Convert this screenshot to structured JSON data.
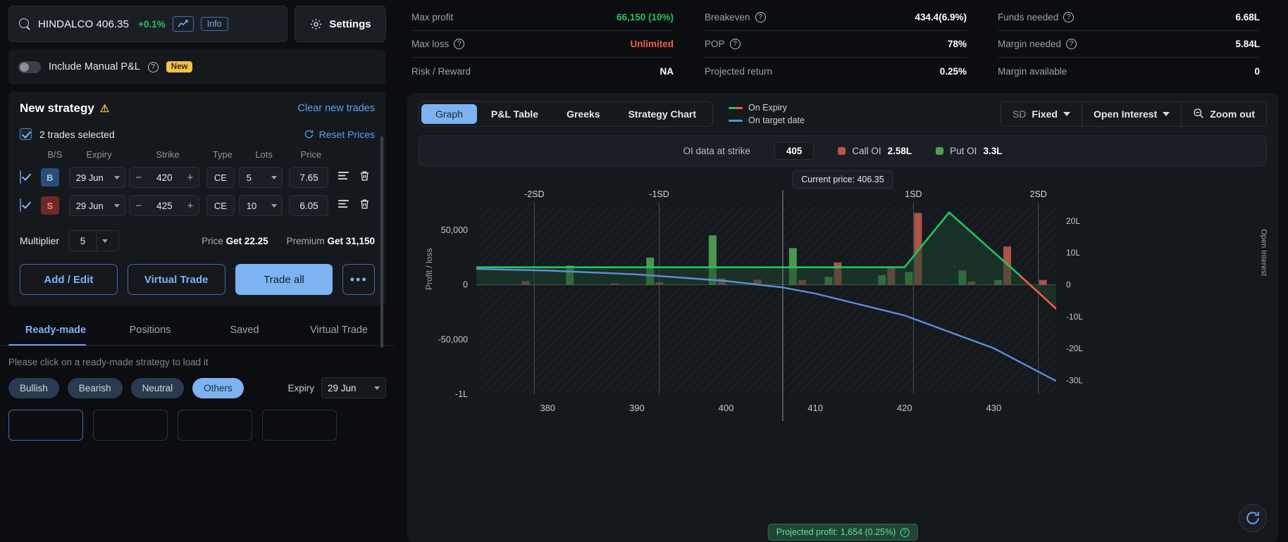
{
  "search": {
    "symbol": "HINDALCO 406.35",
    "change_pct": "+0.1%",
    "info_label": "Info",
    "chart_icon": "line-chart-icon",
    "search_icon": "search-icon"
  },
  "settings": {
    "label": "Settings",
    "icon": "gear-icon"
  },
  "manual_pnl": {
    "label": "Include Manual P&L",
    "badge": "New",
    "toggle_state": "off"
  },
  "strategy": {
    "title": "New strategy",
    "warn_icon": "warning-triangle-icon",
    "clear_label": "Clear new trades",
    "selected_label": "2 trades selected",
    "reset_label": "Reset Prices",
    "columns": [
      "B/S",
      "Expiry",
      "Strike",
      "Type",
      "Lots",
      "Price"
    ],
    "rows": [
      {
        "checked": true,
        "bs": "B",
        "bs_kind": "buy",
        "expiry": "29 Jun",
        "strike": "420",
        "type": "CE",
        "lots": "5",
        "price": "7.65"
      },
      {
        "checked": true,
        "bs": "S",
        "bs_kind": "sell",
        "expiry": "29 Jun",
        "strike": "425",
        "type": "CE",
        "lots": "10",
        "price": "6.05"
      }
    ],
    "multiplier_label": "Multiplier",
    "multiplier_value": "5",
    "price_label": "Price",
    "price_value": "Get 22.25",
    "premium_label": "Premium",
    "premium_value": "Get 31,150",
    "buttons": {
      "add_edit": "Add / Edit",
      "virtual_trade": "Virtual Trade",
      "trade_all": "Trade all",
      "more": "•••"
    }
  },
  "bottom_tabs": {
    "items": [
      "Ready-made",
      "Positions",
      "Saved",
      "Virtual Trade"
    ],
    "active": "Ready-made",
    "hint": "Please click on a ready-made strategy to load it",
    "chips": [
      "Bullish",
      "Bearish",
      "Neutral",
      "Others"
    ],
    "active_chip": "Others",
    "expiry_label": "Expiry",
    "expiry_value": "29 Jun"
  },
  "stats": {
    "col1": [
      {
        "label": "Max profit",
        "value": "66,150 (10%)",
        "tone": "green",
        "help": false
      },
      {
        "label": "Max loss",
        "value": "Unlimited",
        "tone": "red",
        "help": true
      },
      {
        "label": "Risk / Reward",
        "value": "NA",
        "tone": "plain",
        "help": false
      }
    ],
    "col2": [
      {
        "label": "Breakeven",
        "value": "434.4(6.9%)",
        "tone": "plain",
        "help": true
      },
      {
        "label": "POP",
        "value": "78%",
        "tone": "plain",
        "help": true
      },
      {
        "label": "Projected return",
        "value": "0.25%",
        "tone": "plain",
        "help": false
      }
    ],
    "col3": [
      {
        "label": "Funds needed",
        "value": "6.68L",
        "tone": "plain",
        "help": true
      },
      {
        "label": "Margin needed",
        "value": "5.84L",
        "tone": "plain",
        "help": true
      },
      {
        "label": "Margin available",
        "value": "0",
        "tone": "plain",
        "help": false
      }
    ]
  },
  "chart_toolbar": {
    "tabs": [
      "Graph",
      "P&L Table",
      "Greeks",
      "Strategy Chart"
    ],
    "active_tab": "Graph",
    "legend": [
      {
        "name": "On Expiry",
        "key": "on-expiry"
      },
      {
        "name": "On target date",
        "key": "on-target-date"
      }
    ],
    "sd_prefix": "SD",
    "sd_value": "Fixed",
    "oi_button": "Open Interest",
    "zoom_out": "Zoom out",
    "zoom_icon": "zoom-out-icon"
  },
  "oi_bar": {
    "label": "OI data at strike",
    "strike": "405",
    "call_label": "Call OI",
    "call_value": "2.58L",
    "put_label": "Put OI",
    "put_value": "3.3L",
    "call_color": "#b5564c",
    "put_color": "#4f9e53"
  },
  "chart_data": {
    "type": "line",
    "title": "",
    "xlabel": "",
    "ylabel": "Profit / loss",
    "y2label": "Open Interest",
    "current_price_label": "Current price: 406.35",
    "current_price": 406.35,
    "projected_badge": "Projected profit: 1,654 (0.25%)",
    "xlim": [
      372,
      437
    ],
    "xticks": [
      380,
      390,
      400,
      410,
      420,
      430
    ],
    "ylim": [
      -100000,
      75000
    ],
    "yticks": [
      50000,
      0,
      -50000,
      -100000
    ],
    "ytick_labels": [
      "50,000",
      "0",
      "-50,000",
      "-1L"
    ],
    "y2lim": [
      -35,
      25
    ],
    "y2ticks": [
      20,
      10,
      0,
      -10,
      -20,
      -30
    ],
    "y2tick_labels": [
      "20L",
      "10L",
      "0",
      "-10L",
      "-20L",
      "-30L"
    ],
    "sd_markers": [
      {
        "label": "-2SD",
        "x": 378.5
      },
      {
        "label": "-1SD",
        "x": 392.5
      },
      {
        "label": "1SD",
        "x": 421.0
      },
      {
        "label": "2SD",
        "x": 435.0
      }
    ],
    "grid": false,
    "legend_position": "top",
    "series": [
      {
        "name": "On Expiry",
        "color": "#22c55e",
        "loss_color": "#ef5f4a",
        "points": [
          [
            372,
            16000
          ],
          [
            420,
            16000
          ],
          [
            425,
            66150
          ],
          [
            433,
            8000
          ],
          [
            437,
            -22000
          ]
        ]
      },
      {
        "name": "On target date",
        "color": "#5b8fd6",
        "points": [
          [
            372,
            14500
          ],
          [
            380,
            13000
          ],
          [
            390,
            9500
          ],
          [
            400,
            3500
          ],
          [
            406.35,
            -2500
          ],
          [
            410,
            -8000
          ],
          [
            420,
            -28000
          ],
          [
            430,
            -58000
          ],
          [
            437,
            -88000
          ]
        ]
      }
    ],
    "open_interest_bars": [
      {
        "strike": 377,
        "call": 1.2,
        "put": 0.0
      },
      {
        "strike": 383,
        "call": 0.0,
        "put": 6.0
      },
      {
        "strike": 387,
        "call": 0.4,
        "put": 0.0
      },
      {
        "strike": 392,
        "call": 0.8,
        "put": 8.5
      },
      {
        "strike": 399,
        "call": 2.0,
        "put": 15.5
      },
      {
        "strike": 403,
        "call": 1.6,
        "put": 0.0
      },
      {
        "strike": 408,
        "call": 1.5,
        "put": 11.5
      },
      {
        "strike": 412,
        "call": 7.0,
        "put": 2.5
      },
      {
        "strike": 418,
        "call": 5.5,
        "put": 3.0
      },
      {
        "strike": 421,
        "call": 22.5,
        "put": 4.0
      },
      {
        "strike": 427,
        "call": 1.0,
        "put": 4.5
      },
      {
        "strike": 431,
        "call": 12.0,
        "put": 1.5
      },
      {
        "strike": 435,
        "call": 1.5,
        "put": 0.0
      }
    ]
  },
  "reload": {
    "icon": "refresh-icon"
  }
}
